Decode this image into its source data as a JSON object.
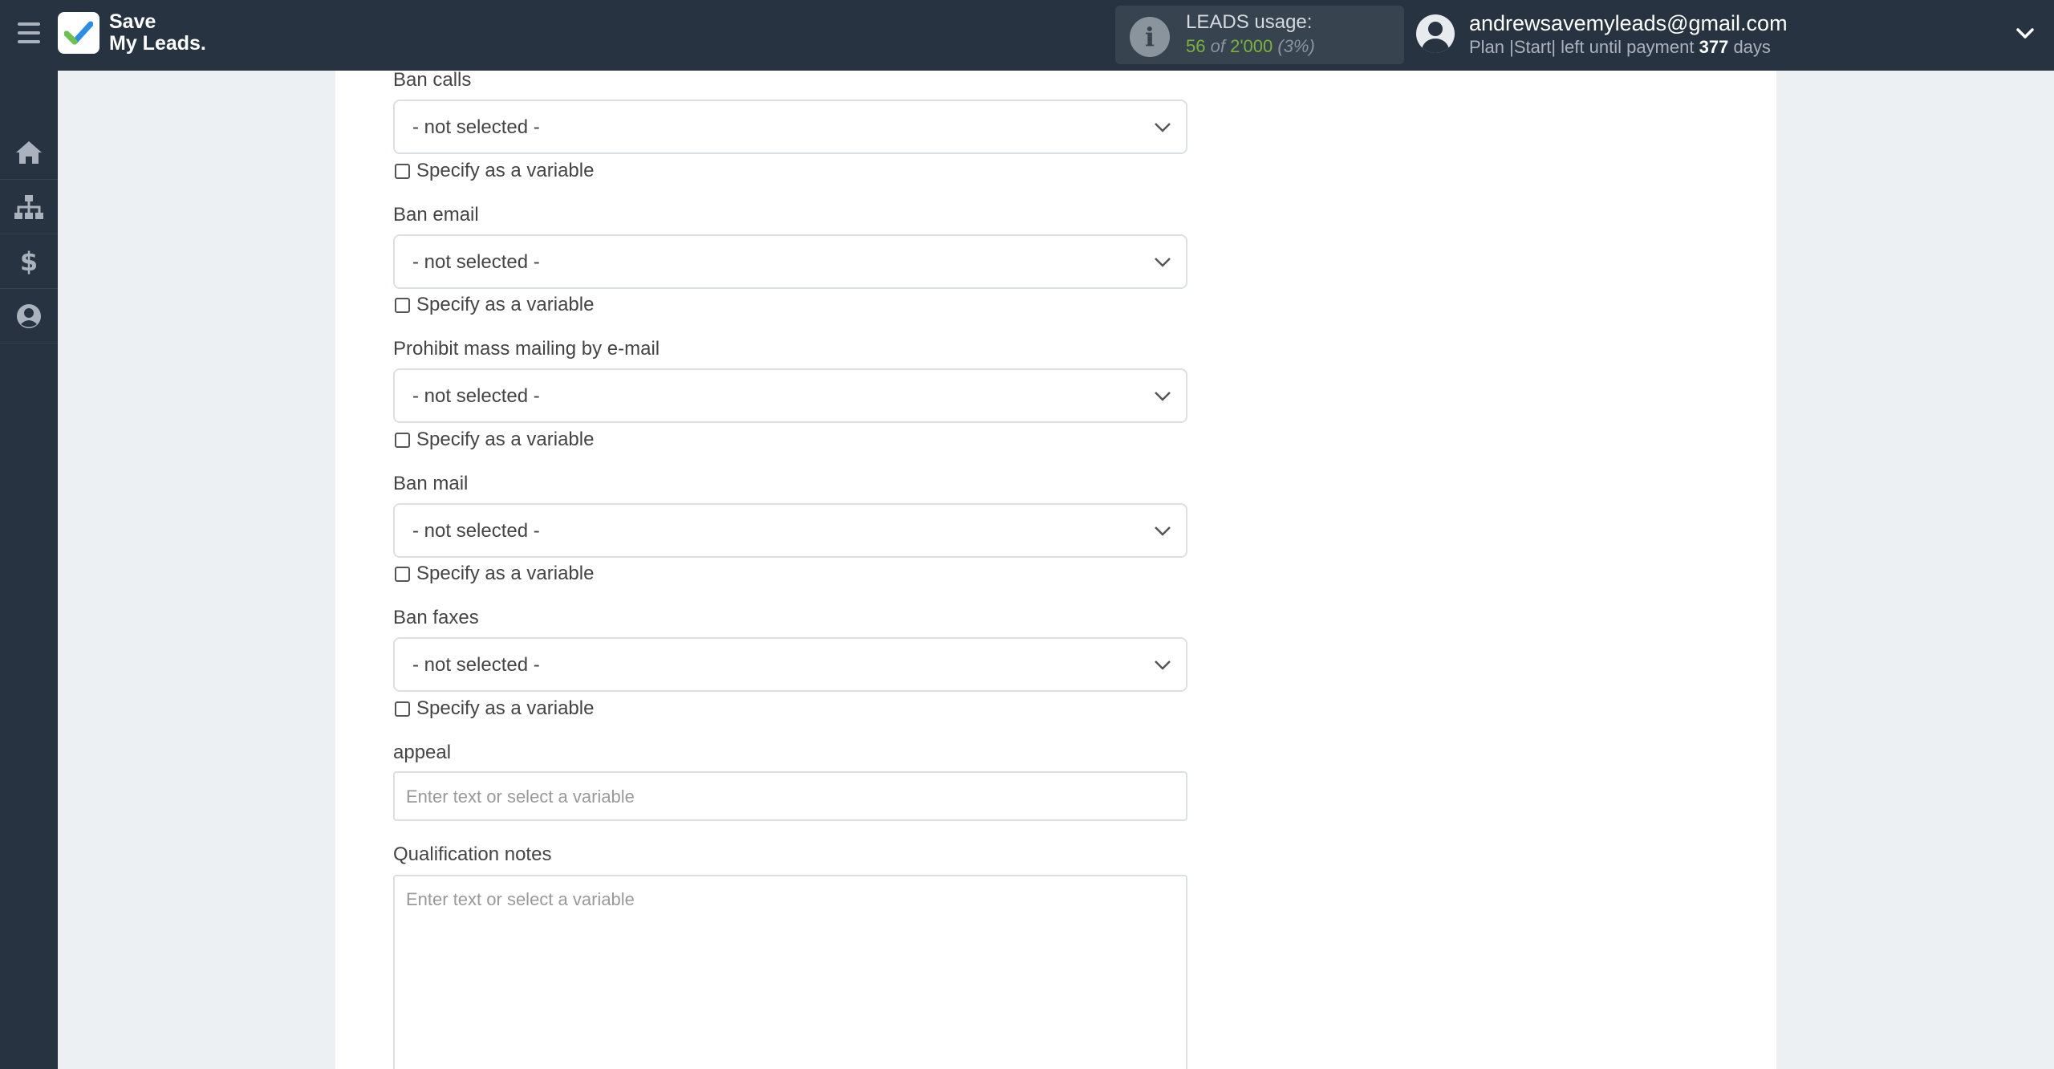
{
  "header": {
    "logo_line1": "Save",
    "logo_line2": "My Leads.",
    "leads_title": "LEADS usage:",
    "leads_used": "56",
    "leads_of": "of",
    "leads_total": "2'000",
    "leads_pct": "(3%)",
    "user_email": "andrewsavemyleads@gmail.com",
    "plan_prefix": "Plan |Start| left until payment",
    "plan_days": "377",
    "plan_suffix": "days"
  },
  "sidebar": {
    "items": [
      {
        "icon": "home-icon"
      },
      {
        "icon": "sitemap-icon"
      },
      {
        "icon": "dollar-icon"
      },
      {
        "icon": "user-circle-icon"
      }
    ]
  },
  "form": {
    "fields": [
      {
        "label": "Ban calls",
        "value": "- not selected -",
        "checkbox": "Specify as a variable"
      },
      {
        "label": "Ban email",
        "value": "- not selected -",
        "checkbox": "Specify as a variable"
      },
      {
        "label": "Prohibit mass mailing by e-mail",
        "value": "- not selected -",
        "checkbox": "Specify as a variable"
      },
      {
        "label": "Ban mail",
        "value": "- not selected -",
        "checkbox": "Specify as a variable"
      },
      {
        "label": "Ban faxes",
        "value": "- not selected -",
        "checkbox": "Specify as a variable"
      }
    ],
    "appeal": {
      "label": "appeal",
      "placeholder": "Enter text or select a variable"
    },
    "notes": {
      "label": "Qualification notes",
      "placeholder": "Enter text or select a variable"
    }
  },
  "colors": {
    "topbar": "#273340",
    "accent_green": "#7ab33b",
    "page_bg": "#edf0f3"
  }
}
